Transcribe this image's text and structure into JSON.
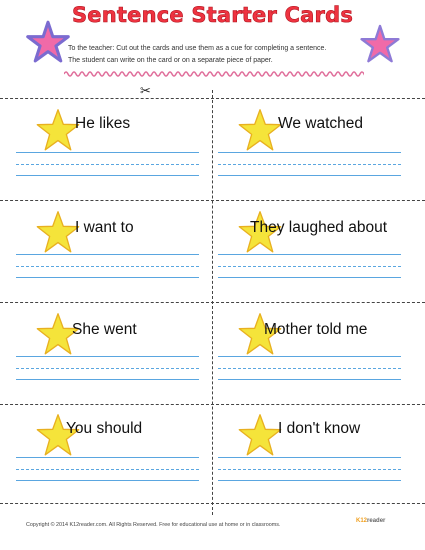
{
  "title": "Sentence Starter Cards",
  "instructions": {
    "line1": "To the teacher: Cut out the cards and use them as a cue for completing a sentence.",
    "line2": "The student can write on the card or on a separate piece of paper."
  },
  "cards": [
    {
      "prompt": "He likes"
    },
    {
      "prompt": "We watched"
    },
    {
      "prompt": "I want to"
    },
    {
      "prompt": "They laughed about"
    },
    {
      "prompt": "She went"
    },
    {
      "prompt": "Mother told me"
    },
    {
      "prompt": "You should"
    },
    {
      "prompt": "I don't know"
    }
  ],
  "footer": "Copyright © 2014 K12reader.com. All Rights Reserved. Free for educational use at home or in classrooms.",
  "logo": {
    "k": "K12",
    "rest": "reader"
  },
  "colors": {
    "title": "#ee3340",
    "star": "#f5e43a",
    "star_outline": "#e8b020",
    "pink_star": "#f06aa8",
    "purple_star": "#8e7ad6",
    "wave": "#e0709c",
    "writing_lines": "#5aa6e0"
  },
  "icons": {
    "scissors": "scissors-icon",
    "stars": "star-icon"
  }
}
